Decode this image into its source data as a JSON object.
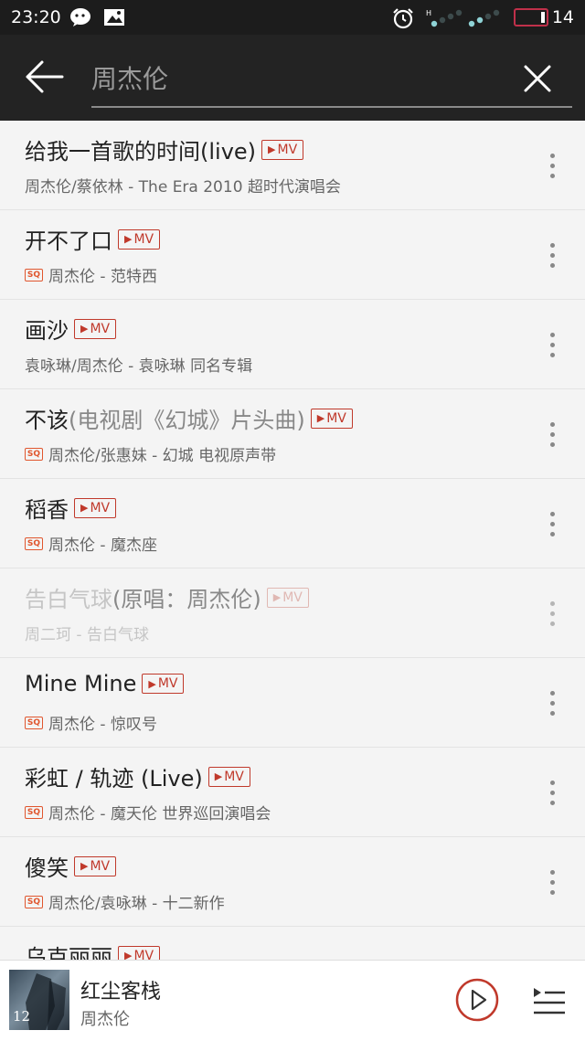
{
  "status_bar": {
    "time": "23:20",
    "battery_level": "14",
    "icons": [
      "wechat-icon",
      "image-icon",
      "alarm-icon",
      "signal-icon",
      "battery-icon"
    ]
  },
  "header": {
    "search_value": "周杰伦",
    "back_icon": "arrow-left-icon",
    "clear_icon": "close-icon"
  },
  "mv_label": "MV",
  "sq_label": "SQ",
  "songs": [
    {
      "title": "给我一首歌的时间(live)",
      "note": "",
      "subtitle": "周杰伦/蔡依林 - The Era 2010 超时代演唱会",
      "sq": false,
      "mv": true,
      "dim": false
    },
    {
      "title": "开不了口",
      "note": "",
      "subtitle": "周杰伦 - 范特西",
      "sq": true,
      "mv": true,
      "dim": false
    },
    {
      "title": "画沙",
      "note": "",
      "subtitle": "袁咏琳/周杰伦 - 袁咏琳 同名专辑",
      "sq": false,
      "mv": true,
      "dim": false
    },
    {
      "title": "不该",
      "note": " (电视剧《幻城》片头曲)",
      "subtitle": "周杰伦/张惠妹 - 幻城 电视原声带",
      "sq": true,
      "mv": true,
      "dim": false
    },
    {
      "title": "稻香",
      "note": "",
      "subtitle": "周杰伦 - 魔杰座",
      "sq": true,
      "mv": true,
      "dim": false
    },
    {
      "title": "告白气球",
      "note": " (原唱：周杰伦)",
      "subtitle": "周二珂 - 告白气球",
      "sq": false,
      "mv": true,
      "dim": true
    },
    {
      "title": "Mine Mine",
      "note": "",
      "subtitle": "周杰伦 - 惊叹号",
      "sq": true,
      "mv": true,
      "dim": false
    },
    {
      "title": "彩虹 / 轨迹 (Live)",
      "note": "",
      "subtitle": "周杰伦 - 魔天伦 世界巡回演唱会",
      "sq": true,
      "mv": true,
      "dim": false
    },
    {
      "title": "傻笑",
      "note": "",
      "subtitle": "周杰伦/袁咏琳 - 十二新作",
      "sq": true,
      "mv": true,
      "dim": false
    },
    {
      "title": "乌克丽丽",
      "note": "",
      "subtitle": "",
      "sq": false,
      "mv": true,
      "dim": false
    }
  ],
  "player": {
    "title": "红尘客栈",
    "artist": "周杰伦",
    "cover_text": "12",
    "accent": "#c0392b"
  },
  "colors": {
    "header_bg": "#232323",
    "list_bg": "#f4f4f4",
    "mv_red": "#c0392b",
    "sq_orange": "#e0562e"
  }
}
